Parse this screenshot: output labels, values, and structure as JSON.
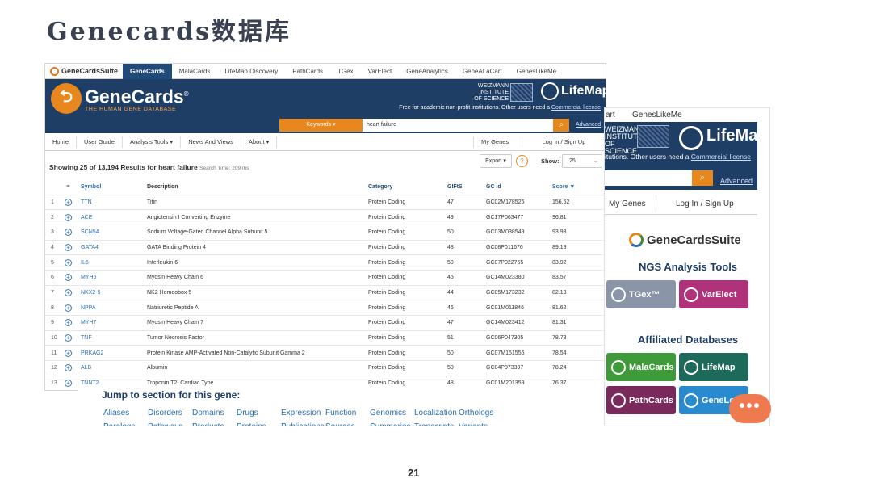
{
  "slide": {
    "title": "Genecards数据库",
    "page_number": "21"
  },
  "suite_bar": {
    "logo": "GeneCardsSuite",
    "tabs": [
      "GeneCards",
      "MalaCards",
      "LifeMap Discovery",
      "PathCards",
      "TGex",
      "VarElect",
      "GeneAnalytics",
      "GeneALaCart",
      "GenesLikeMe"
    ],
    "active_tab": "GeneCards"
  },
  "banner": {
    "logo_name": "GeneCards",
    "logo_mark": "®",
    "logo_tagline": "THE HUMAN GENE DATABASE",
    "weizmann": "WEIZMANN INSTITUTE OF SCIENCE",
    "lifemap": "LifeMap",
    "note_prefix": "Free for academic non-profit institutions. Other users need a ",
    "note_link": "Commercial license"
  },
  "search": {
    "keywords_label": "Keywords ▾",
    "query": "heart failure",
    "button_icon": "search-icon",
    "advanced": "Advanced"
  },
  "nav": {
    "left": [
      "Home",
      "User Guide",
      "Analysis Tools ▾",
      "News And Views",
      "About ▾"
    ],
    "my_genes": "My Genes",
    "login": "Log In  /  Sign Up"
  },
  "results": {
    "summary_bold": "Showing 25 of 13,194 Results for heart failure",
    "search_time": "Search Time: 209 ms",
    "export": "Export ▾",
    "help": "?",
    "show_label": "Show:",
    "show_value": "25",
    "columns": [
      "Symbol",
      "Description",
      "Category",
      "GIFtS",
      "GC id",
      "Score ▼"
    ],
    "rows": [
      {
        "n": "1",
        "sym": "TTN",
        "desc": "Titin",
        "cat": "Protein Coding",
        "gifts": "47",
        "gc": "GC02M178525",
        "score": "156.52"
      },
      {
        "n": "2",
        "sym": "ACE",
        "desc": "Angiotensin I Converting Enzyme",
        "cat": "Protein Coding",
        "gifts": "49",
        "gc": "GC17P063477",
        "score": "96.81"
      },
      {
        "n": "3",
        "sym": "SCN5A",
        "desc": "Sodium Voltage-Gated Channel Alpha Subunit 5",
        "cat": "Protein Coding",
        "gifts": "50",
        "gc": "GC03M038549",
        "score": "93.98"
      },
      {
        "n": "4",
        "sym": "GATA4",
        "desc": "GATA Binding Protein 4",
        "cat": "Protein Coding",
        "gifts": "48",
        "gc": "GC08P011676",
        "score": "89.18"
      },
      {
        "n": "5",
        "sym": "IL6",
        "desc": "Interleukin 6",
        "cat": "Protein Coding",
        "gifts": "50",
        "gc": "GC07P022765",
        "score": "83.92"
      },
      {
        "n": "6",
        "sym": "MYH6",
        "desc": "Myosin Heavy Chain 6",
        "cat": "Protein Coding",
        "gifts": "45",
        "gc": "GC14M023380",
        "score": "83.57"
      },
      {
        "n": "7",
        "sym": "NKX2-5",
        "desc": "NK2 Homeobox 5",
        "cat": "Protein Coding",
        "gifts": "44",
        "gc": "GC05M173232",
        "score": "82.13"
      },
      {
        "n": "8",
        "sym": "NPPA",
        "desc": "Natriuretic Peptide A",
        "cat": "Protein Coding",
        "gifts": "46",
        "gc": "GC01M011846",
        "score": "81.62"
      },
      {
        "n": "9",
        "sym": "MYH7",
        "desc": "Myosin Heavy Chain 7",
        "cat": "Protein Coding",
        "gifts": "47",
        "gc": "GC14M023412",
        "score": "81.31"
      },
      {
        "n": "10",
        "sym": "TNF",
        "desc": "Tumor Necrosis Factor",
        "cat": "Protein Coding",
        "gifts": "51",
        "gc": "GC06P047305",
        "score": "78.73"
      },
      {
        "n": "11",
        "sym": "PRKAG2",
        "desc": "Protein Kinase AMP-Activated Non-Catalytic Subunit Gamma 2",
        "cat": "Protein Coding",
        "gifts": "50",
        "gc": "GC07M151556",
        "score": "78.54"
      },
      {
        "n": "12",
        "sym": "ALB",
        "desc": "Albumin",
        "cat": "Protein Coding",
        "gifts": "50",
        "gc": "GC04P073397",
        "score": "78.24"
      },
      {
        "n": "13",
        "sym": "TNNT2",
        "desc": "Troponin T2, Cardiac Type",
        "cat": "Protein Coding",
        "gifts": "48",
        "gc": "GC01M201359",
        "score": "76.37"
      }
    ]
  },
  "jump": {
    "title": "Jump to section for this gene:",
    "row1": [
      "Aliases",
      "Disorders",
      "Domains",
      "Drugs",
      "Expression",
      "Function",
      "Genomics",
      "Localization",
      "Orthologs"
    ],
    "row2": [
      "Paralogs",
      "Pathways",
      "Products",
      "Proteins",
      "Publications",
      "Sources",
      "Summaries",
      "Transcripts",
      "Variants"
    ]
  },
  "right_panel": {
    "top_tabs": [
      "art",
      "GenesLikeMe"
    ],
    "weizmann": "WEIZMANN INSTITUTE OF SCIENCE",
    "lifemap": "LifeMap",
    "note_prefix": "itutions. Other users need a ",
    "note_link": "Commercial license",
    "advanced": "Advanced",
    "my_genes": "My Genes",
    "login": "Log In  /  Sign Up",
    "suite_logo": "GeneCardsSuite",
    "ngs_title": "NGS Analysis Tools",
    "ngs_tiles": [
      {
        "label": "TGex™",
        "color": "#8a96a8"
      },
      {
        "label": "VarElect",
        "color": "#b0327a"
      }
    ],
    "aff_title": "Affiliated Databases",
    "aff_tiles": [
      {
        "label": "MalaCards",
        "color": "#3f9a3a"
      },
      {
        "label": "LifeMap",
        "color": "#1e6a5a"
      },
      {
        "label": "PathCards",
        "color": "#7a2a5a"
      },
      {
        "label": "GeneLo",
        "color": "#2a8ad0"
      }
    ]
  },
  "chat_button": "•••",
  "colors": {
    "navy": "#1f3e66",
    "orange": "#e8871e",
    "link": "#2a6fb3"
  }
}
